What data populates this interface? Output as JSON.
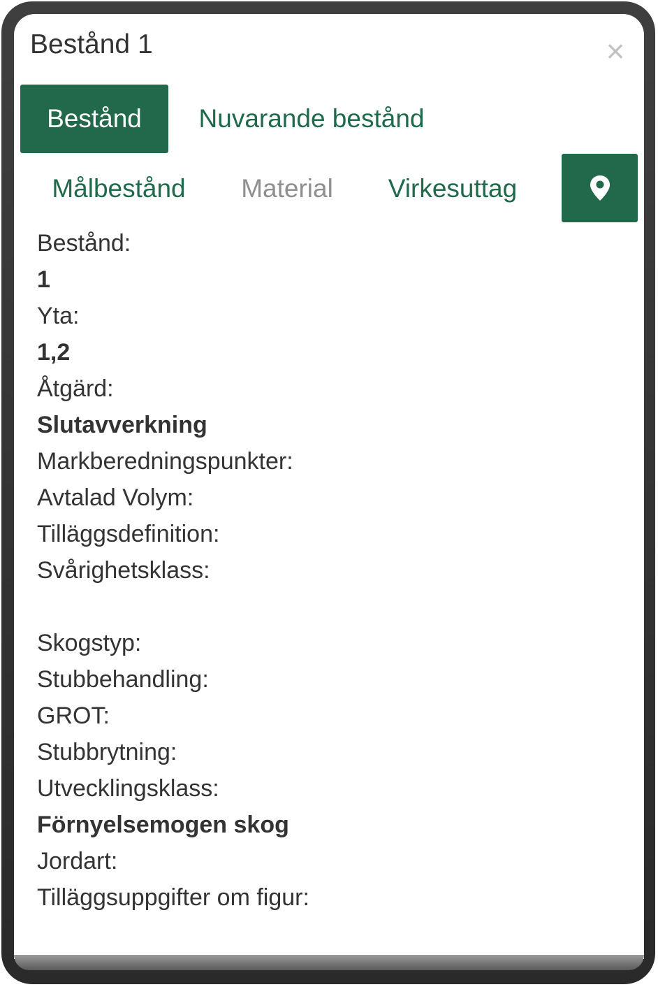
{
  "dialog": {
    "title": "Bestånd 1",
    "close_label": "×"
  },
  "tabs": [
    {
      "label": "Bestånd",
      "active": true
    },
    {
      "label": "Nuvarande bestånd",
      "active": false
    },
    {
      "label": "Målbestånd",
      "active": false
    },
    {
      "label": "Material",
      "active": false,
      "disabled": true
    },
    {
      "label": "Virkesuttag",
      "active": false
    }
  ],
  "location_button": {
    "icon": "map-marker-icon"
  },
  "fields": {
    "bestand_label": "Bestånd:",
    "bestand_value": "1",
    "yta_label": "Yta:",
    "yta_value": "1,2",
    "atgard_label": "Åtgärd:",
    "atgard_value": "Slutavverkning",
    "markberedning_label": "Markberedningspunkter:",
    "avtalad_volym_label": "Avtalad Volym:",
    "tillaggsdefinition_label": "Tilläggsdefinition:",
    "svarighetsklass_label": "Svårighetsklass:",
    "skogstyp_label": "Skogstyp:",
    "stubbehandling_label": "Stubbehandling:",
    "grot_label": "GROT:",
    "stubbrytning_label": "Stubbrytning:",
    "utvecklingsklass_label": "Utvecklingsklass:",
    "utvecklingsklass_value": "Förnyelsemogen skog",
    "jordart_label": "Jordart:",
    "tillaggsuppgifter_label": "Tilläggsuppgifter om figur:"
  },
  "colors": {
    "accent": "#22684a",
    "tab_text": "#1f6a4a",
    "muted": "#8f8f8f",
    "text": "#333333"
  }
}
